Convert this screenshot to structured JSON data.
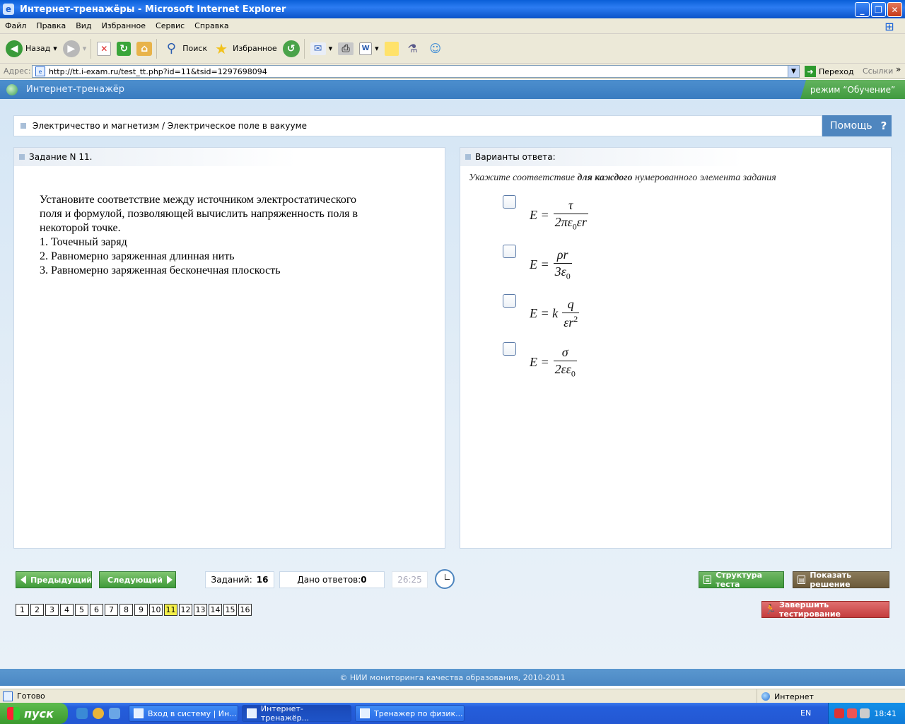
{
  "window": {
    "title": "Интернет-тренажёры - Microsoft Internet Explorer",
    "app_icon": "ie-icon",
    "controls": [
      "minimize-icon",
      "maximize-icon",
      "close-icon"
    ]
  },
  "menu": {
    "items": [
      "Файл",
      "Правка",
      "Вид",
      "Избранное",
      "Сервис",
      "Справка"
    ]
  },
  "toolbar": {
    "back": "Назад",
    "search": "Поиск",
    "favorites": "Избранное"
  },
  "address": {
    "label": "Адрес:",
    "url": "http://tt.i-exam.ru/test_tt.php?id=11&tsid=1297698094",
    "go": "Переход",
    "links": "Ссылки"
  },
  "app": {
    "name": "Интернет-тренажёр",
    "mode": "режим “Обучение”",
    "breadcrumb": "Электричество и магнетизм / Электрическое поле в вакууме",
    "help": "Помощь",
    "help_glyph": "?"
  },
  "task": {
    "header": "Задание N 11.",
    "question": [
      "Установите соответствие между источником электростатического",
      "поля и формулой, позволяющей вычислить напряженность поля в",
      "некоторой точке.",
      "1. Точечный заряд",
      "2. Равномерно заряженная длинная нить",
      "3. Равномерно заряженная бесконечная плоскость"
    ]
  },
  "answers": {
    "header": "Варианты ответа:",
    "instruction_pre": "Укажите соответствие ",
    "instruction_bold": "для каждого",
    "instruction_post": " нумерованного элемента задания",
    "options": [
      {
        "lhs": "E =",
        "num": "τ",
        "den_main": "2πε",
        "den_sub": "0",
        "den_tail": "εr"
      },
      {
        "lhs": "E =",
        "num": "ρr",
        "den_main": "3ε",
        "den_sub": "0",
        "den_tail": ""
      },
      {
        "lhs": "E = k",
        "num": "q",
        "den_main": "εr",
        "den_sup": "2"
      },
      {
        "lhs": "E =",
        "num": "σ",
        "den_main": "2εε",
        "den_sub": "0",
        "den_tail": ""
      }
    ]
  },
  "nav": {
    "prev": "Предыдущий",
    "next": "Следующий",
    "tasks_label": "Заданий:",
    "tasks_count": "16",
    "answered_label": "Дано ответов:",
    "answered_count": "0",
    "timer": "26:25",
    "structure": "Структура теста",
    "show_solution": "Показать решение",
    "finish": "Завершить тестирование",
    "pages": [
      "1",
      "2",
      "3",
      "4",
      "5",
      "6",
      "7",
      "8",
      "9",
      "10",
      "11",
      "12",
      "13",
      "14",
      "15",
      "16"
    ],
    "current_page": "11"
  },
  "footer": {
    "text": "© НИИ мониторинга качества образования, 2010-2011"
  },
  "status": {
    "text": "Готово",
    "zone": "Интернет"
  },
  "taskbar": {
    "start": "пуск",
    "tasks": [
      "Вход в систему | Ин...",
      "Интернет-тренажёр...",
      "Тренажер по физик..."
    ],
    "lang": "EN",
    "time": "18:41"
  }
}
